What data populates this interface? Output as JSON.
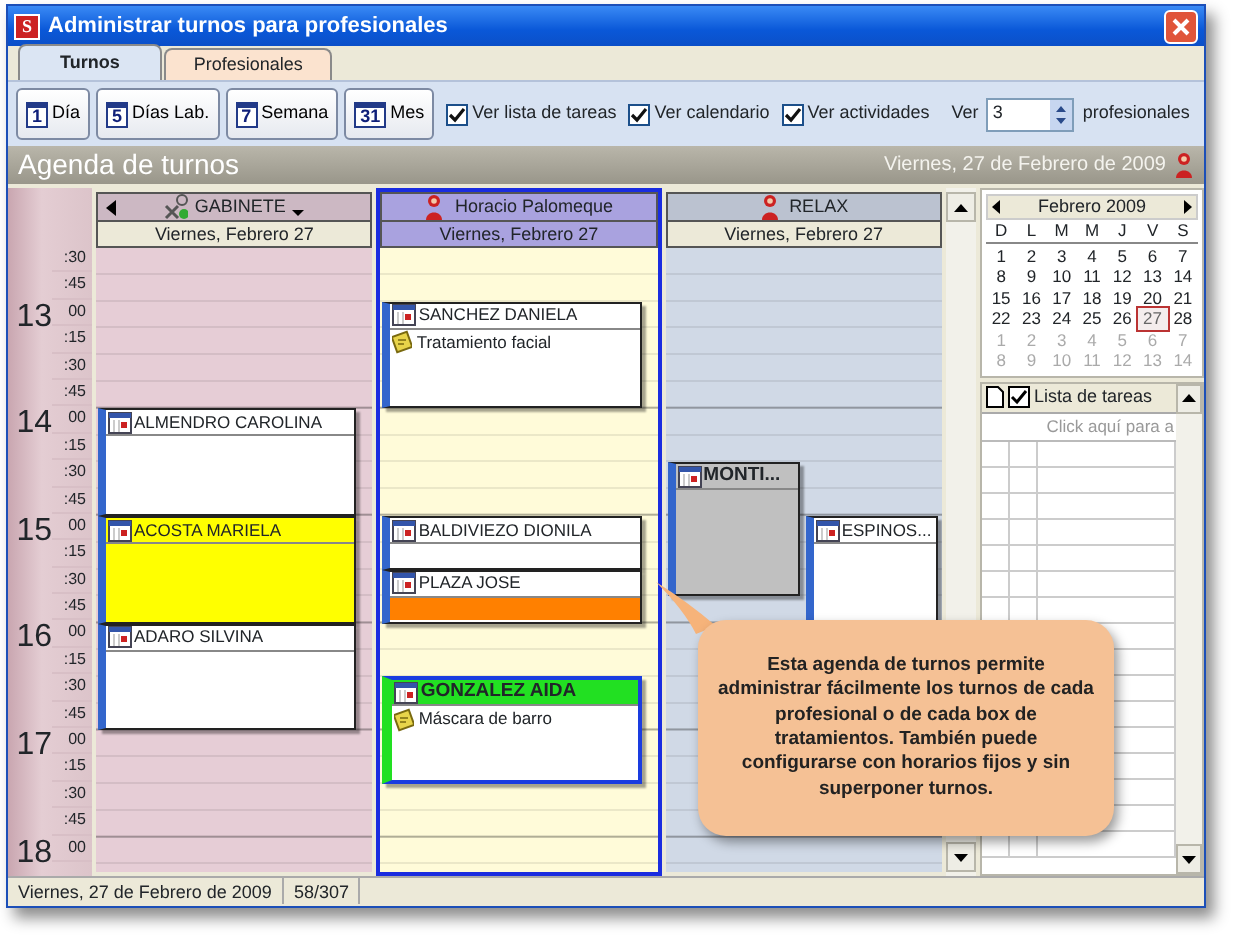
{
  "window": {
    "title": "Administrar turnos para profesionales",
    "icon_letter": "S"
  },
  "tabs": [
    {
      "label": "Turnos",
      "selected": true
    },
    {
      "label": "Profesionales",
      "selected": false
    }
  ],
  "toolbar": {
    "view_buttons": [
      {
        "number": "1",
        "label": "Día"
      },
      {
        "number": "5",
        "label": "Días Lab."
      },
      {
        "number": "7",
        "label": "Semana"
      },
      {
        "number": "31",
        "label": "Mes"
      }
    ],
    "checkboxes": [
      {
        "label": "Ver lista de tareas",
        "checked": true
      },
      {
        "label": "Ver calendario",
        "checked": true
      },
      {
        "label": "Ver actividades",
        "checked": true
      }
    ],
    "count": {
      "label": "Ver",
      "value": "3",
      "suffix": "profesionales"
    }
  },
  "agenda_header": {
    "title": "Agenda de turnos",
    "date": "Viernes, 27 de Febrero de 2009"
  },
  "time_labels": [
    {
      "minutes": [
        ":30",
        ":45"
      ]
    },
    {
      "hour": "13",
      "minutes": [
        "00",
        ":15",
        ":30",
        ":45"
      ]
    },
    {
      "hour": "14",
      "minutes": [
        "00",
        ":15",
        ":30",
        ":45"
      ]
    },
    {
      "hour": "15",
      "minutes": [
        "00",
        ":15",
        ":30",
        ":45"
      ]
    },
    {
      "hour": "16",
      "minutes": [
        "00",
        ":15",
        ":30",
        ":45"
      ]
    },
    {
      "hour": "17",
      "minutes": [
        "00",
        ":15",
        ":30",
        ":45"
      ]
    },
    {
      "hour": "18",
      "minutes": [
        "00"
      ]
    }
  ],
  "columns": [
    {
      "name": "GABINETE",
      "date": "Viernes, Febrero 27",
      "color": "#e6cdd6",
      "selected": false,
      "nav_left": true,
      "dropdown": true,
      "appointments": [
        {
          "name": "ALMENDRO CAROLINA",
          "kind": "plain",
          "selected": false,
          "emphasis": false
        },
        {
          "name": "ACOSTA MARIELA",
          "kind": "filled",
          "color": "#ffff00",
          "selected": false,
          "emphasis": false
        },
        {
          "name": "ADARO SILVINA",
          "kind": "plain",
          "selected": false,
          "emphasis": false
        }
      ]
    },
    {
      "name": "Horacio Palomeque",
      "date": "Viernes, Febrero 27",
      "color": "#fffbd9",
      "selected": true,
      "nav_left": false,
      "dropdown": false,
      "appointments": [
        {
          "name": "SANCHEZ DANIELA",
          "note": "Tratamiento facial",
          "kind": "plain",
          "selected": false,
          "emphasis": false
        },
        {
          "name": "BALDIVIEZO DIONILA",
          "kind": "plain",
          "selected": false,
          "emphasis": false
        },
        {
          "name": "PLAZA JOSE",
          "kind": "lower",
          "color": "#ff8000",
          "selected": false,
          "emphasis": false
        },
        {
          "name": "GONZALEZ AIDA",
          "note": "Máscara de barro",
          "kind": "banner",
          "color": "#22e022",
          "selected": true,
          "emphasis": true
        }
      ]
    },
    {
      "name": "RELAX",
      "date": "Viernes, Febrero 27",
      "color": "#d0d9e6",
      "selected": false,
      "nav_left": false,
      "dropdown": false,
      "appointments": [
        {
          "name": "MONTI...",
          "kind": "filled",
          "color": "#c0c0c0",
          "selected": false,
          "emphasis": true
        },
        {
          "name": "ESPINOS...",
          "kind": "plain",
          "selected": false,
          "emphasis": false
        }
      ]
    }
  ],
  "calendar": {
    "month": "Febrero 2009",
    "weekdays": [
      "D",
      "L",
      "M",
      "M",
      "J",
      "V",
      "S"
    ],
    "weeks": [
      [
        {
          "day": "1",
          "muted": false,
          "selected": false
        },
        {
          "day": "2",
          "muted": false,
          "selected": false
        },
        {
          "day": "3",
          "muted": false,
          "selected": false
        },
        {
          "day": "4",
          "muted": false,
          "selected": false
        },
        {
          "day": "5",
          "muted": false,
          "selected": false
        },
        {
          "day": "6",
          "muted": false,
          "selected": false
        },
        {
          "day": "7",
          "muted": false,
          "selected": false
        }
      ],
      [
        {
          "day": "8",
          "muted": false,
          "selected": false
        },
        {
          "day": "9",
          "muted": false,
          "selected": false
        },
        {
          "day": "10",
          "muted": false,
          "selected": false
        },
        {
          "day": "11",
          "muted": false,
          "selected": false
        },
        {
          "day": "12",
          "muted": false,
          "selected": false
        },
        {
          "day": "13",
          "muted": false,
          "selected": false
        },
        {
          "day": "14",
          "muted": false,
          "selected": false
        }
      ],
      [
        {
          "day": "15",
          "muted": false,
          "selected": false
        },
        {
          "day": "16",
          "muted": false,
          "selected": false
        },
        {
          "day": "17",
          "muted": false,
          "selected": false
        },
        {
          "day": "18",
          "muted": false,
          "selected": false
        },
        {
          "day": "19",
          "muted": false,
          "selected": false
        },
        {
          "day": "20",
          "muted": false,
          "selected": false
        },
        {
          "day": "21",
          "muted": false,
          "selected": false
        }
      ],
      [
        {
          "day": "22",
          "muted": false,
          "selected": false
        },
        {
          "day": "23",
          "muted": false,
          "selected": false
        },
        {
          "day": "24",
          "muted": false,
          "selected": false
        },
        {
          "day": "25",
          "muted": false,
          "selected": false
        },
        {
          "day": "26",
          "muted": false,
          "selected": false
        },
        {
          "day": "27",
          "muted": false,
          "selected": true
        },
        {
          "day": "28",
          "muted": false,
          "selected": false
        }
      ],
      [
        {
          "day": "1",
          "muted": true,
          "selected": false
        },
        {
          "day": "2",
          "muted": true,
          "selected": false
        },
        {
          "day": "3",
          "muted": true,
          "selected": false
        },
        {
          "day": "4",
          "muted": true,
          "selected": false
        },
        {
          "day": "5",
          "muted": true,
          "selected": false
        },
        {
          "day": "6",
          "muted": true,
          "selected": false
        },
        {
          "day": "7",
          "muted": true,
          "selected": false
        }
      ],
      [
        {
          "day": "8",
          "muted": true,
          "selected": false
        },
        {
          "day": "9",
          "muted": true,
          "selected": false
        },
        {
          "day": "10",
          "muted": true,
          "selected": false
        },
        {
          "day": "11",
          "muted": true,
          "selected": false
        },
        {
          "day": "12",
          "muted": true,
          "selected": false
        },
        {
          "day": "13",
          "muted": true,
          "selected": false
        },
        {
          "day": "14",
          "muted": true,
          "selected": false
        }
      ]
    ]
  },
  "task_list": {
    "title": "Lista de tareas",
    "placeholder": "Click aquí para a"
  },
  "callout": {
    "text": "Esta agenda de turnos permite administrar fácilmente los turnos de cada profesional o de cada box de tratamientos. También puede configurarse con horarios fijos y sin superponer turnos."
  },
  "status_bar": [
    "Viernes, 27 de Febrero de 2009",
    "58/307"
  ]
}
